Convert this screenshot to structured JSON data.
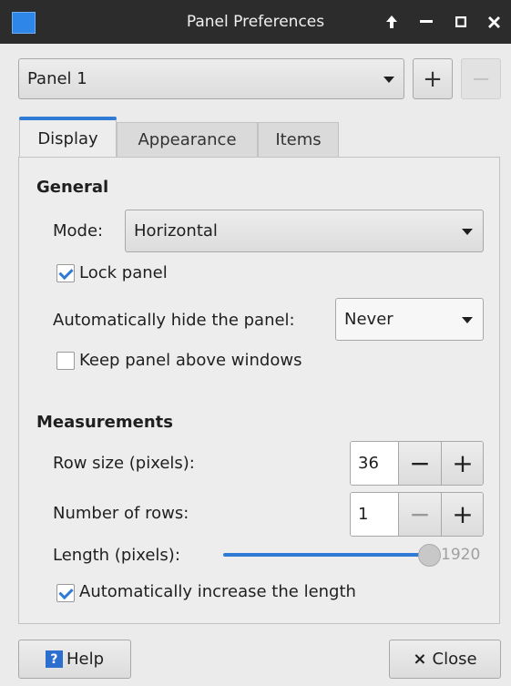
{
  "window": {
    "title": "Panel Preferences"
  },
  "titlebar_icons": [
    "arrow-up-icon",
    "minimize-icon",
    "maximize-icon",
    "close-icon"
  ],
  "panel_selector": {
    "value": "Panel 1",
    "add_label": "+",
    "remove_label": "−"
  },
  "tabs": [
    {
      "label": "Display",
      "active": true
    },
    {
      "label": "Appearance",
      "active": false
    },
    {
      "label": "Items",
      "active": false
    }
  ],
  "general": {
    "heading": "General",
    "mode_label": "Mode:",
    "mode_value": "Horizontal",
    "lock_panel_label": "Lock panel",
    "lock_panel_checked": true,
    "autohide_label": "Automatically hide the panel:",
    "autohide_value": "Never",
    "keep_above_label": "Keep panel above windows",
    "keep_above_checked": false
  },
  "measurements": {
    "heading": "Measurements",
    "row_size_label": "Row size (pixels):",
    "row_size_value": "36",
    "rows_label": "Number of rows:",
    "rows_value": "1",
    "length_label": "Length (pixels):",
    "length_value": "1920",
    "auto_length_label": "Automatically increase the length",
    "auto_length_checked": true
  },
  "footer": {
    "help_icon": "?",
    "help_label": "Help",
    "close_icon": "×",
    "close_label": "Close"
  },
  "colors": {
    "accent": "#2f7ad4",
    "titlebar": "#2c2c2c"
  }
}
